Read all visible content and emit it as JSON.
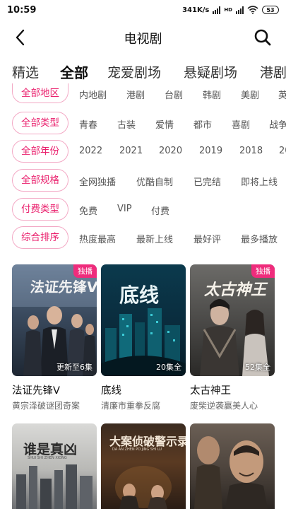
{
  "status": {
    "time": "10:59",
    "net_speed": "341K/s",
    "hd": "HD",
    "battery": "53"
  },
  "header": {
    "title": "电视剧",
    "back_icon": "back-arrow-icon",
    "search_icon": "search-icon"
  },
  "tabs": [
    {
      "label": "精选",
      "active": false
    },
    {
      "label": "全部",
      "active": true
    },
    {
      "label": "宠爱剧场",
      "active": false
    },
    {
      "label": "悬疑剧场",
      "active": false
    },
    {
      "label": "港剧",
      "active": false
    }
  ],
  "filters": {
    "region": {
      "label": "全部地区",
      "options": [
        "内地剧",
        "港剧",
        "台剧",
        "韩剧",
        "美剧",
        "英"
      ]
    },
    "type": {
      "label": "全部类型",
      "options": [
        "青春",
        "古装",
        "爱情",
        "都市",
        "喜剧",
        "战争"
      ]
    },
    "year": {
      "label": "全部年份",
      "options": [
        "2022",
        "2021",
        "2020",
        "2019",
        "2018",
        "20"
      ]
    },
    "spec": {
      "label": "全部规格",
      "options": [
        "全网独播",
        "优酷自制",
        "已完结",
        "即将上线"
      ]
    },
    "pay": {
      "label": "付费类型",
      "options": [
        "免费",
        "VIP",
        "付费"
      ]
    },
    "sort": {
      "label": "综合排序",
      "options": [
        "热度最高",
        "最新上线",
        "最好评",
        "最多播放"
      ]
    }
  },
  "shows": [
    {
      "title": "法证先锋V",
      "subtitle": "黄宗泽破谜团奇案",
      "badge": "独播",
      "episodes": "更新至6集",
      "poster_text": "法证先锋V"
    },
    {
      "title": "底线",
      "subtitle": "清廉市重拳反腐",
      "badge": "",
      "episodes": "20集全",
      "poster_text": "底线"
    },
    {
      "title": "太古神王",
      "subtitle": "废柴逆袭赢美人心",
      "badge": "独播",
      "episodes": "52集全",
      "poster_text": "太古神王"
    },
    {
      "title": "",
      "subtitle": "",
      "badge": "",
      "episodes": "",
      "poster_text": "谁是真凶",
      "poster_sub": "SHUI SHI ZHEN XIONG"
    },
    {
      "title": "",
      "subtitle": "",
      "badge": "",
      "episodes": "",
      "poster_text": "大案侦破警示录",
      "poster_sub": "DA AN ZHEN PO JING SHI LU"
    },
    {
      "title": "",
      "subtitle": "",
      "badge": "",
      "episodes": "",
      "poster_text": ""
    }
  ],
  "colors": {
    "accent": "#ea1f6c",
    "pill_border": "#f3a9c5",
    "badge": "#ef2c7c"
  }
}
